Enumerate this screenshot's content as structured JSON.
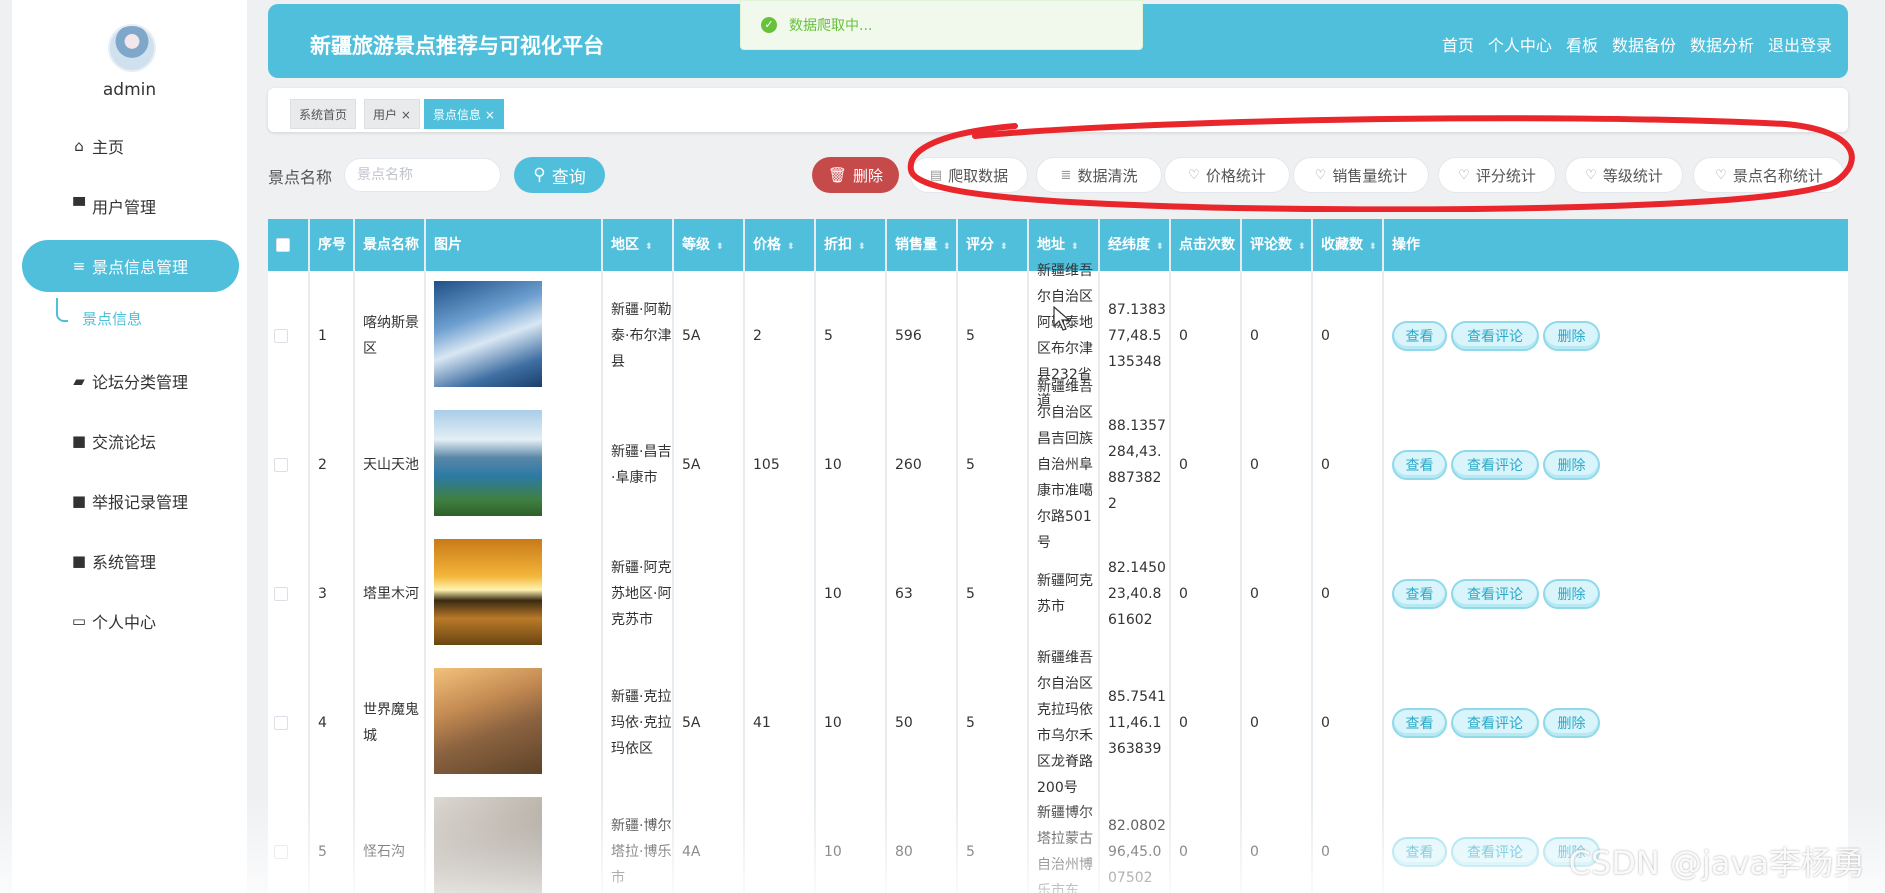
{
  "sidebar": {
    "username": "admin",
    "items": [
      {
        "label": "主页",
        "icon": "home-icon"
      },
      {
        "label": "用户管理",
        "icon": "monitor-icon"
      },
      {
        "label": "景点信息管理",
        "icon": "list-icon"
      },
      {
        "label": "论坛分类管理",
        "icon": "briefcase-icon"
      },
      {
        "label": "交流论坛",
        "icon": "grid-icon"
      },
      {
        "label": "举报记录管理",
        "icon": "grid-icon"
      },
      {
        "label": "系统管理",
        "icon": "grid-icon"
      },
      {
        "label": "个人中心",
        "icon": "card-icon"
      }
    ],
    "sub_item": "景点信息"
  },
  "header": {
    "title": "新疆旅游景点推荐与可视化平台",
    "nav": [
      "首页",
      "个人中心",
      "看板",
      "数据备份",
      "数据分析",
      "退出登录"
    ]
  },
  "toast": {
    "text": "数据爬取中..."
  },
  "tabs": [
    "系统首页",
    "用户",
    "景点信息"
  ],
  "toolbar": {
    "search_label": "景点名称",
    "search_placeholder": "景点名称",
    "query_label": "查询",
    "delete_label": "删除",
    "buttons": [
      "爬取数据",
      "数据清洗",
      "价格统计",
      "销售量统计",
      "评分统计",
      "等级统计",
      "景点名称统计"
    ]
  },
  "table": {
    "headers": [
      "序号",
      "景点名称",
      "图片",
      "地区",
      "等级",
      "价格",
      "折扣",
      "销售量",
      "评分",
      "地址",
      "经纬度",
      "点击次数",
      "评论数",
      "收藏数",
      "操作"
    ],
    "row_actions": [
      "查看",
      "查看评论",
      "删除"
    ],
    "rows": [
      {
        "seq": "1",
        "name": "喀纳斯景区",
        "region": "新疆·阿勒泰·布尔津县",
        "level": "5A",
        "price": "2",
        "discount": "5",
        "sales": "596",
        "rating": "5",
        "address": "新疆维吾尔自治区阿勒泰地区布尔津县232省道",
        "coords": "87.138377,48.5135348",
        "clicks": "0",
        "comments": "0",
        "favorites": "0"
      },
      {
        "seq": "2",
        "name": "天山天池",
        "region": "新疆·昌吉·阜康市",
        "level": "5A",
        "price": "105",
        "discount": "10",
        "sales": "260",
        "rating": "5",
        "address": "新疆维吾尔自治区昌吉回族自治州阜康市准噶尔路501号",
        "coords": "88.1357284,43.8873822",
        "clicks": "0",
        "comments": "0",
        "favorites": "0"
      },
      {
        "seq": "3",
        "name": "塔里木河",
        "region": "新疆·阿克苏地区·阿克苏市",
        "level": "",
        "price": "",
        "discount": "10",
        "sales": "63",
        "rating": "5",
        "address": "新疆阿克苏市",
        "coords": "82.145023,40.861602",
        "clicks": "0",
        "comments": "0",
        "favorites": "0"
      },
      {
        "seq": "4",
        "name": "世界魔鬼城",
        "region": "新疆·克拉玛依·克拉玛依区",
        "level": "5A",
        "price": "41",
        "discount": "10",
        "sales": "50",
        "rating": "5",
        "address": "新疆维吾尔自治区克拉玛依市乌尔禾区龙脊路200号",
        "coords": "85.754111,46.1363839",
        "clicks": "0",
        "comments": "0",
        "favorites": "0"
      },
      {
        "seq": "5",
        "name": "怪石沟",
        "region": "新疆·博尔塔拉·博乐市",
        "level": "4A",
        "price": "",
        "discount": "10",
        "sales": "80",
        "rating": "5",
        "address": "新疆博尔塔拉蒙古自治州博乐市东",
        "coords": "82.080296,45.007502",
        "clicks": "0",
        "comments": "0",
        "favorites": "0"
      }
    ]
  },
  "watermark": "CSDN @java李杨勇",
  "colors": {
    "accent": "#4fbfdb",
    "danger": "#c74a4a",
    "toast": "#67c23a",
    "annotation": "#e8262b"
  }
}
